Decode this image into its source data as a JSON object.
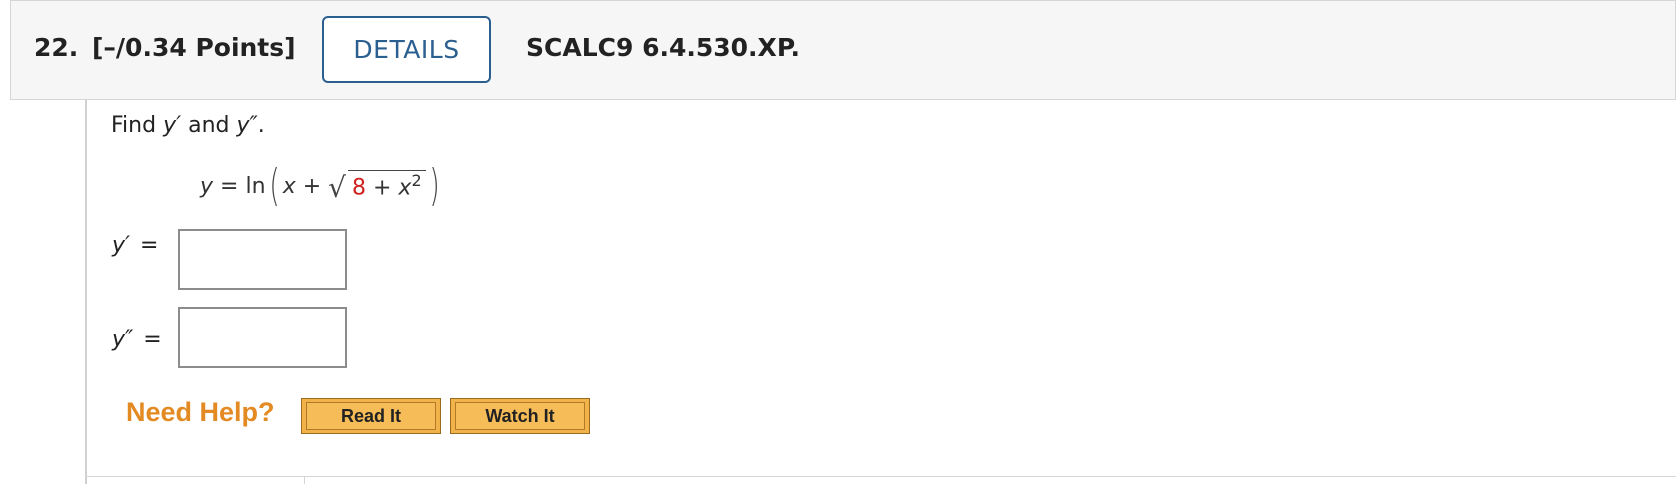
{
  "question": {
    "number": "22.",
    "points": "[–/0.34 Points]",
    "details_label": "DETAILS",
    "code": "SCALC9 6.4.530.XP."
  },
  "problem": {
    "prompt_text": "Find",
    "prompt_y1": "y′",
    "prompt_and": "and",
    "prompt_y2": "y″",
    "prompt_period": ".",
    "equation": {
      "lhs": "y",
      "eq": " = ",
      "fn": "ln",
      "x": "x",
      "plus": " + ",
      "radicand_const": "8",
      "radicand_plus": " + ",
      "radicand_var": "x",
      "exponent": "2",
      "const_color": "#d0201f"
    }
  },
  "answers": [
    {
      "label": "y′",
      "eq": "=",
      "value": ""
    },
    {
      "label": "y″",
      "eq": "=",
      "value": ""
    }
  ],
  "help": {
    "title": "Need Help?",
    "read_label": "Read It",
    "watch_label": "Watch It"
  }
}
